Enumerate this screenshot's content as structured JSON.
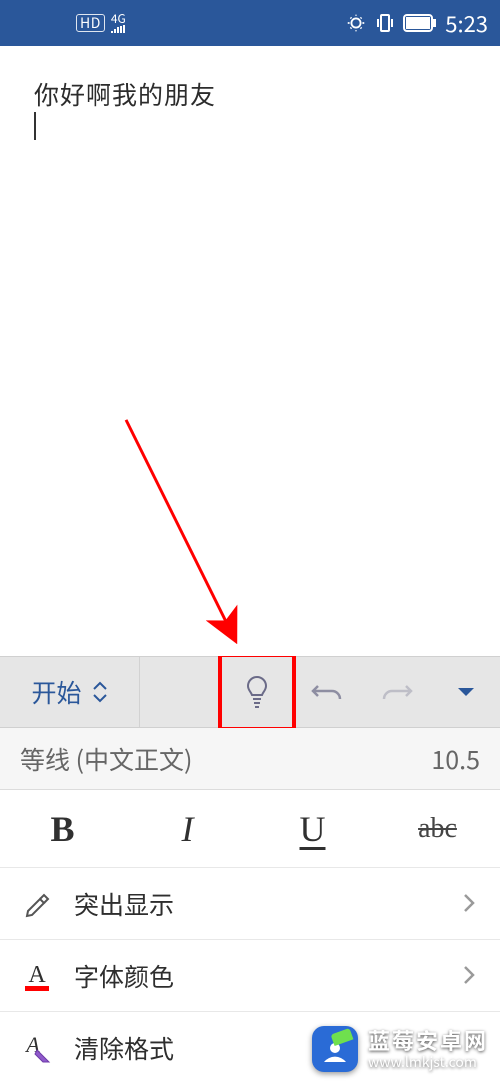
{
  "status_bar": {
    "hd": "HD",
    "net": "4G",
    "time": "5:23"
  },
  "document": {
    "text": "你好啊我的朋友"
  },
  "toolbar": {
    "tab_label": "开始"
  },
  "font_row": {
    "font_name": "等线 (中文正文)",
    "font_size": "10.5"
  },
  "format_buttons": {
    "bold": "B",
    "italic": "I",
    "underline": "U",
    "strike": "abc"
  },
  "menu": {
    "highlight": "突出显示",
    "font_color": "字体颜色",
    "clear_format": "清除格式"
  },
  "watermark": {
    "title": "蓝莓安卓网",
    "url": "www.lmkjst.com"
  }
}
